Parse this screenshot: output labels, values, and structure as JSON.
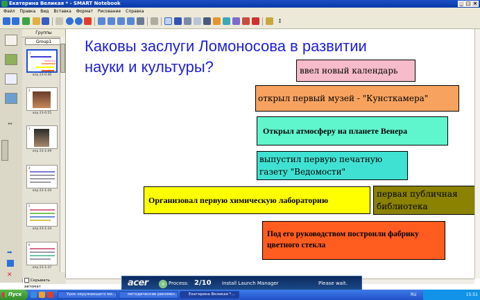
{
  "window": {
    "title": "Екатерина Великая * - SMART Notebook",
    "controls": [
      "_",
      "□",
      "×"
    ]
  },
  "menu": [
    "Файл",
    "Правка",
    "Вид",
    "Вставка",
    "Формат",
    "Рисование",
    "Справка"
  ],
  "sorter": {
    "header": "Группы",
    "group": "Group1",
    "thumbnails": [
      {
        "num": "1",
        "label": "апр 23-0:46"
      },
      {
        "num": "2",
        "label": "апр 23-0:55"
      },
      {
        "num": "3",
        "label": "апр 23-1:09"
      },
      {
        "num": "4",
        "label": "апр 23-1:20"
      },
      {
        "num": "5",
        "label": "апр 23-1:34"
      },
      {
        "num": "6",
        "label": "апр 23-1:37"
      }
    ],
    "hide_label": "Скрывать автомат"
  },
  "slide": {
    "question": "Каковы заслуги Ломоносова в развитии науки и культуры?",
    "question_line1": "Каковы заслуги Ломоносова в развитии",
    "question_line2": "науки и культуры?",
    "answers": {
      "calendar": "ввел новый календарь",
      "museum": "открыл первый музей - \"Кунсткамера\"",
      "venus": "Открыл атмосферу на планете Венера",
      "newspaper": "выпустил первую печатную газету \"Ведомости\"",
      "chemlab": "Организовал первую химическую лабораторию",
      "library": "первая публичная библиотека",
      "glass": "Под его руководством построили фабрику цветного стекла"
    },
    "colors": {
      "calendar": "#f6bccb",
      "museum": "#f7a35f",
      "venus": "#5ff5cd",
      "newspaper": "#3fe2d2",
      "chemlab": "#ffff00",
      "library": "#8a8200",
      "glass": "#ff5c1f",
      "question": "#1d1fd8"
    }
  },
  "popup": {
    "brand": "acer",
    "process_label": "Process:",
    "process_count": "2/10",
    "process_name": "Install Launch Manager",
    "status": "Please wait."
  },
  "taskbar": {
    "start": "Пуск",
    "tasks": [
      "Урок окружающего ми...",
      "методические рекомен...",
      "Екатерина Великая *..."
    ],
    "lang": "RU",
    "clock": "15:51"
  }
}
